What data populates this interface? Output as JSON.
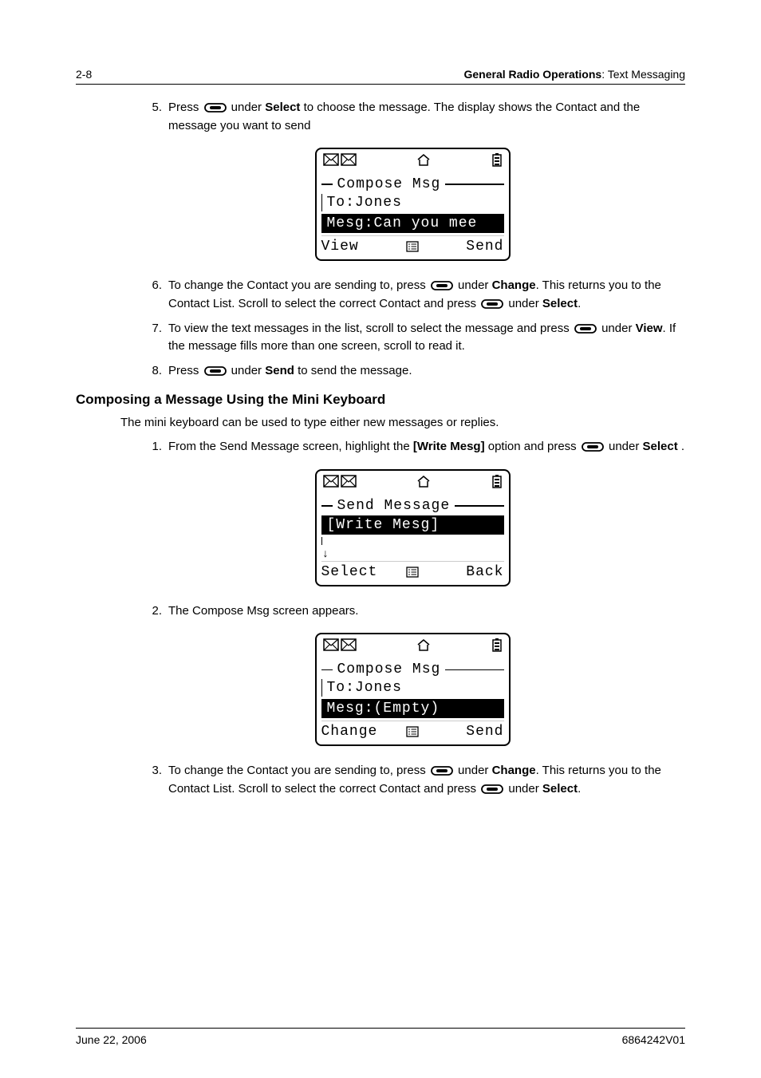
{
  "header": {
    "page_num": "2-8",
    "right_bold": "General Radio Operations",
    "right_rest": ": Text Messaging"
  },
  "steps_top": [
    {
      "n": "5.",
      "parts": [
        "Press ",
        "BTN",
        " under ",
        "B:Select",
        " to choose the message. The display shows the Contact and the message you want to send"
      ]
    }
  ],
  "lcd1": {
    "title": "Compose Msg",
    "row1": "To:Jones",
    "row2": "Mesg:Can you mee",
    "sk_left": "View",
    "sk_right": "Send"
  },
  "steps_mid": [
    {
      "n": "6.",
      "parts": [
        "To change the Contact you are sending to, press ",
        "BTN",
        " under ",
        "B:Change",
        ". This returns you to the Contact List. Scroll to select the correct Contact and press ",
        "BTN",
        " under ",
        "B:Select",
        "."
      ]
    },
    {
      "n": "7.",
      "parts": [
        "To view the text messages in the list, scroll to select the message and press ",
        "BTN",
        " under ",
        "B:View",
        ". If the message fills more than one screen, scroll to read it."
      ]
    },
    {
      "n": "8.",
      "parts": [
        "Press ",
        "BTN",
        " under ",
        "B:Send",
        " to send the message."
      ]
    }
  ],
  "section_heading": "Composing a Message Using the Mini Keyboard",
  "section_intro": "The mini keyboard can be used to type either new messages or replies.",
  "steps_bottom1": [
    {
      "n": "1.",
      "parts": [
        "From the Send Message screen, highlight the ",
        "B:[Write Mesg]",
        " option and press ",
        "BTN",
        " under ",
        "B:Select",
        " ."
      ]
    }
  ],
  "lcd2": {
    "title": "Send Message",
    "row1": "[Write Mesg]",
    "sk_left": "Select",
    "sk_right": "Back"
  },
  "steps_bottom2": [
    {
      "n": "2.",
      "parts": [
        "The Compose Msg screen appears."
      ]
    }
  ],
  "lcd3": {
    "title": "Compose Msg",
    "row1": "To:Jones",
    "row2": "Mesg:(Empty)",
    "sk_left": "Change",
    "sk_right": "Send"
  },
  "steps_bottom3": [
    {
      "n": "3.",
      "parts": [
        "To change the Contact you are sending to, press ",
        "BTN",
        " under ",
        "B:Change",
        ". This returns you to the Contact List. Scroll to select the correct Contact and press ",
        "BTN",
        " under ",
        "B:Select",
        "."
      ]
    }
  ],
  "footer": {
    "left": "June 22, 2006",
    "right": "6864242V01"
  }
}
